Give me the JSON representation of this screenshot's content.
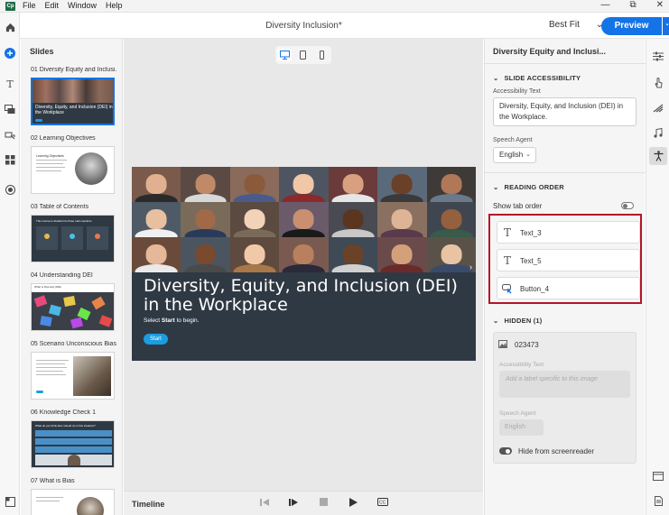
{
  "app": {
    "logo_text": "Cp",
    "menu": [
      "File",
      "Edit",
      "Window",
      "Help"
    ],
    "window_controls": [
      "—",
      "⧉",
      "✕"
    ]
  },
  "toolbar": {
    "doc_title": "Diversity Inclusion*",
    "fit_label": "Best Fit",
    "fit_chevron": "⌄",
    "preview_label": "Preview",
    "more_label": "···"
  },
  "rail": {
    "icons": [
      "home-icon",
      "add-icon",
      "text-icon",
      "media-icon",
      "interactions-icon",
      "widgets-icon",
      "record-icon",
      "filmstrip-icon"
    ]
  },
  "slides_panel": {
    "header": "Slides",
    "items": [
      {
        "label": "01  Diversity Equity and Inclusi..."
      },
      {
        "label": "02  Learning Objectives"
      },
      {
        "label": "03  Table of Contents"
      },
      {
        "label": "04  Understanding DEI"
      },
      {
        "label": "05  Scenario Unconscious Bias"
      },
      {
        "label": "06  Knowledge Check 1"
      },
      {
        "label": "07  What is Bias"
      }
    ],
    "thumb1_title": "Diversity, Equity, and Inclusion (DEI) in the Workplace",
    "thumb2_title": "Learning Objectives",
    "thumb3_title": "This course is divided into three main sections",
    "thumb4_title": "What is Diversity (DEI)",
    "thumb6_title": "What do you think Alex should do in this situation?"
  },
  "stage": {
    "slide_title": "Diversity, Equity, and Inclusion (DEI) in the Workplace",
    "slide_sub_pre": "Select ",
    "slide_sub_bold": "Start",
    "slide_sub_post": " to begin.",
    "start_label": "Start",
    "next_arrow": "›"
  },
  "timeline": {
    "label": "Timeline"
  },
  "properties": {
    "title": "Diversity Equity and Inclusi...",
    "slide_accessibility": {
      "heading": "SLIDE ACCESSIBILITY",
      "text_label": "Accessibility Text",
      "text_value": "Diversity, Equity, and Inclusion (DEI) in the Workplace.",
      "agent_label": "Speech Agent",
      "agent_value": "English"
    },
    "reading_order": {
      "heading": "READING ORDER",
      "show_tab_label": "Show tab order",
      "items": [
        {
          "label": "Text_3"
        },
        {
          "label": "Text_5"
        },
        {
          "label": "Button_4"
        }
      ]
    },
    "hidden": {
      "heading": "HIDDEN (1)",
      "item_name": "023473",
      "acc_label": "Accessibility Text",
      "acc_placeholder": "Add a label specific to this image",
      "agent_label": "Speech Agent",
      "agent_value": "English",
      "hide_label": "Hide from screenreader"
    }
  },
  "colors": {
    "accent": "#1473e6",
    "highlight_border": "#b4142a",
    "slide_overlay": "#2f3944"
  }
}
